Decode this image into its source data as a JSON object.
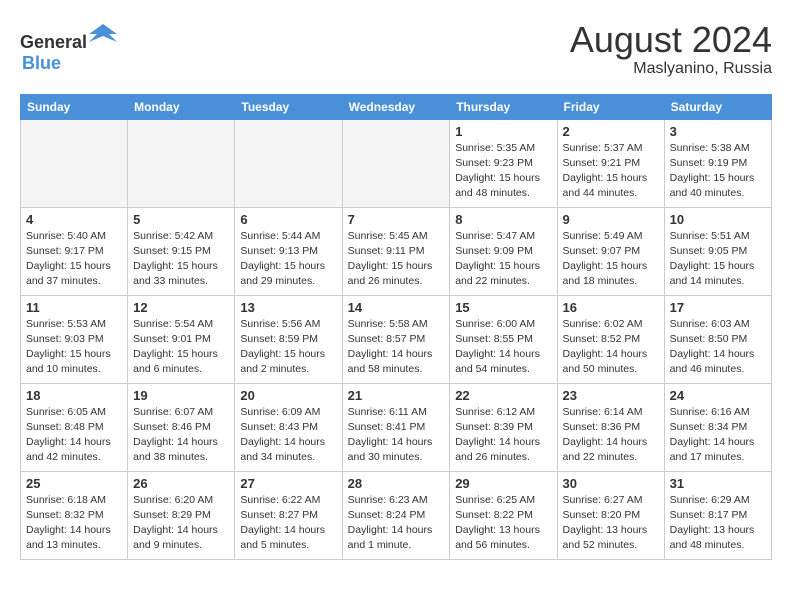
{
  "header": {
    "logo_general": "General",
    "logo_blue": "Blue",
    "month_year": "August 2024",
    "location": "Maslyanino, Russia"
  },
  "weekdays": [
    "Sunday",
    "Monday",
    "Tuesday",
    "Wednesday",
    "Thursday",
    "Friday",
    "Saturday"
  ],
  "weeks": [
    [
      {
        "day": "",
        "info": "",
        "empty": true
      },
      {
        "day": "",
        "info": "",
        "empty": true
      },
      {
        "day": "",
        "info": "",
        "empty": true
      },
      {
        "day": "",
        "info": "",
        "empty": true
      },
      {
        "day": "1",
        "info": "Sunrise: 5:35 AM\nSunset: 9:23 PM\nDaylight: 15 hours\nand 48 minutes."
      },
      {
        "day": "2",
        "info": "Sunrise: 5:37 AM\nSunset: 9:21 PM\nDaylight: 15 hours\nand 44 minutes."
      },
      {
        "day": "3",
        "info": "Sunrise: 5:38 AM\nSunset: 9:19 PM\nDaylight: 15 hours\nand 40 minutes."
      }
    ],
    [
      {
        "day": "4",
        "info": "Sunrise: 5:40 AM\nSunset: 9:17 PM\nDaylight: 15 hours\nand 37 minutes."
      },
      {
        "day": "5",
        "info": "Sunrise: 5:42 AM\nSunset: 9:15 PM\nDaylight: 15 hours\nand 33 minutes."
      },
      {
        "day": "6",
        "info": "Sunrise: 5:44 AM\nSunset: 9:13 PM\nDaylight: 15 hours\nand 29 minutes."
      },
      {
        "day": "7",
        "info": "Sunrise: 5:45 AM\nSunset: 9:11 PM\nDaylight: 15 hours\nand 26 minutes."
      },
      {
        "day": "8",
        "info": "Sunrise: 5:47 AM\nSunset: 9:09 PM\nDaylight: 15 hours\nand 22 minutes."
      },
      {
        "day": "9",
        "info": "Sunrise: 5:49 AM\nSunset: 9:07 PM\nDaylight: 15 hours\nand 18 minutes."
      },
      {
        "day": "10",
        "info": "Sunrise: 5:51 AM\nSunset: 9:05 PM\nDaylight: 15 hours\nand 14 minutes."
      }
    ],
    [
      {
        "day": "11",
        "info": "Sunrise: 5:53 AM\nSunset: 9:03 PM\nDaylight: 15 hours\nand 10 minutes."
      },
      {
        "day": "12",
        "info": "Sunrise: 5:54 AM\nSunset: 9:01 PM\nDaylight: 15 hours\nand 6 minutes."
      },
      {
        "day": "13",
        "info": "Sunrise: 5:56 AM\nSunset: 8:59 PM\nDaylight: 15 hours\nand 2 minutes."
      },
      {
        "day": "14",
        "info": "Sunrise: 5:58 AM\nSunset: 8:57 PM\nDaylight: 14 hours\nand 58 minutes."
      },
      {
        "day": "15",
        "info": "Sunrise: 6:00 AM\nSunset: 8:55 PM\nDaylight: 14 hours\nand 54 minutes."
      },
      {
        "day": "16",
        "info": "Sunrise: 6:02 AM\nSunset: 8:52 PM\nDaylight: 14 hours\nand 50 minutes."
      },
      {
        "day": "17",
        "info": "Sunrise: 6:03 AM\nSunset: 8:50 PM\nDaylight: 14 hours\nand 46 minutes."
      }
    ],
    [
      {
        "day": "18",
        "info": "Sunrise: 6:05 AM\nSunset: 8:48 PM\nDaylight: 14 hours\nand 42 minutes."
      },
      {
        "day": "19",
        "info": "Sunrise: 6:07 AM\nSunset: 8:46 PM\nDaylight: 14 hours\nand 38 minutes."
      },
      {
        "day": "20",
        "info": "Sunrise: 6:09 AM\nSunset: 8:43 PM\nDaylight: 14 hours\nand 34 minutes."
      },
      {
        "day": "21",
        "info": "Sunrise: 6:11 AM\nSunset: 8:41 PM\nDaylight: 14 hours\nand 30 minutes."
      },
      {
        "day": "22",
        "info": "Sunrise: 6:12 AM\nSunset: 8:39 PM\nDaylight: 14 hours\nand 26 minutes."
      },
      {
        "day": "23",
        "info": "Sunrise: 6:14 AM\nSunset: 8:36 PM\nDaylight: 14 hours\nand 22 minutes."
      },
      {
        "day": "24",
        "info": "Sunrise: 6:16 AM\nSunset: 8:34 PM\nDaylight: 14 hours\nand 17 minutes."
      }
    ],
    [
      {
        "day": "25",
        "info": "Sunrise: 6:18 AM\nSunset: 8:32 PM\nDaylight: 14 hours\nand 13 minutes."
      },
      {
        "day": "26",
        "info": "Sunrise: 6:20 AM\nSunset: 8:29 PM\nDaylight: 14 hours\nand 9 minutes."
      },
      {
        "day": "27",
        "info": "Sunrise: 6:22 AM\nSunset: 8:27 PM\nDaylight: 14 hours\nand 5 minutes."
      },
      {
        "day": "28",
        "info": "Sunrise: 6:23 AM\nSunset: 8:24 PM\nDaylight: 14 hours\nand 1 minute."
      },
      {
        "day": "29",
        "info": "Sunrise: 6:25 AM\nSunset: 8:22 PM\nDaylight: 13 hours\nand 56 minutes."
      },
      {
        "day": "30",
        "info": "Sunrise: 6:27 AM\nSunset: 8:20 PM\nDaylight: 13 hours\nand 52 minutes."
      },
      {
        "day": "31",
        "info": "Sunrise: 6:29 AM\nSunset: 8:17 PM\nDaylight: 13 hours\nand 48 minutes."
      }
    ]
  ]
}
